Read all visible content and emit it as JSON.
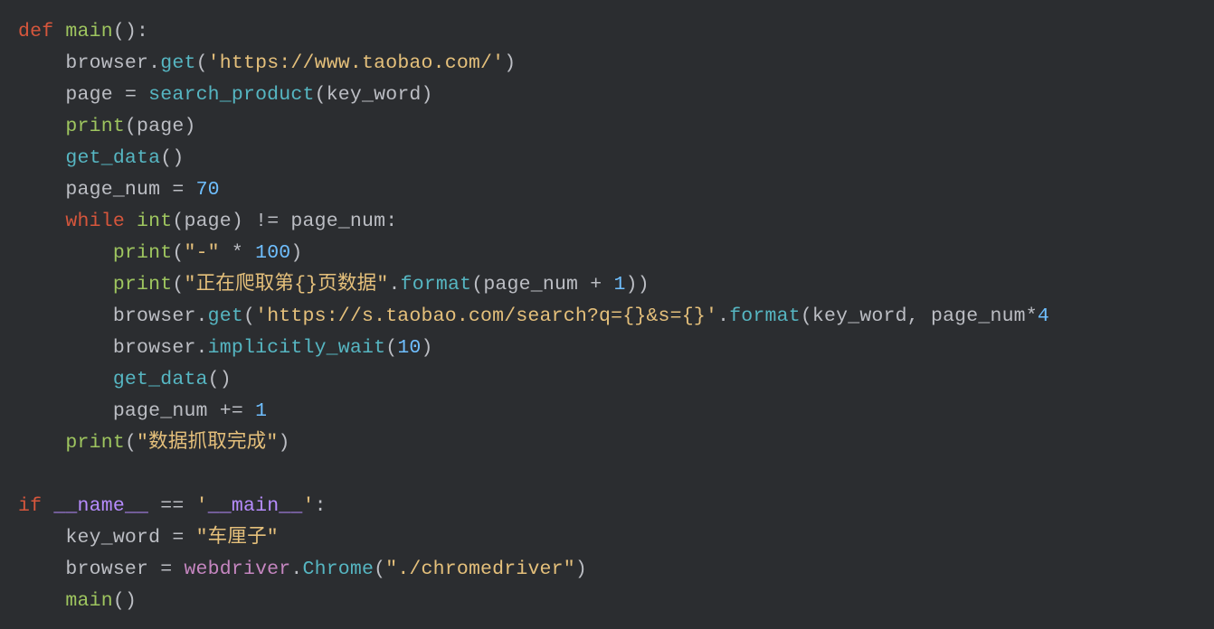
{
  "code": {
    "l1": {
      "kw": "def",
      "sp": " ",
      "name": "main",
      "paren": "():"
    },
    "l2": {
      "indent": "    ",
      "obj": "browser",
      "dot": ".",
      "meth": "get",
      "open": "(",
      "q": "'",
      "str": "https://www.taobao.com/",
      "q2": "'",
      "close": ")"
    },
    "l3": {
      "indent": "    ",
      "lhs": "page",
      "eq": " = ",
      "fn": "search_product",
      "open": "(",
      "arg": "key_word",
      "close": ")"
    },
    "l4": {
      "indent": "    ",
      "fn": "print",
      "open": "(",
      "arg": "page",
      "close": ")"
    },
    "l5": {
      "indent": "    ",
      "fn": "get_data",
      "paren": "()"
    },
    "l6": {
      "indent": "    ",
      "lhs": "page_num",
      "eq": " = ",
      "num": "70"
    },
    "l7": {
      "indent": "    ",
      "kw": "while",
      "sp": " ",
      "fn": "int",
      "open": "(",
      "arg": "page",
      "close": ")",
      "op": " != ",
      "rhs": "page_num",
      "colon": ":"
    },
    "l8": {
      "indent": "        ",
      "fn": "print",
      "open": "(",
      "q": "\"",
      "str": "-",
      "q2": "\"",
      "op": " * ",
      "num": "100",
      "close": ")"
    },
    "l9": {
      "indent": "        ",
      "fn": "print",
      "open": "(",
      "q": "\"",
      "str": "正在爬取第{}页数据",
      "q2": "\"",
      "dot": ".",
      "meth": "format",
      "open2": "(",
      "arg": "page_num",
      "op": " + ",
      "num": "1",
      "close2": ")",
      ")": ")"
    },
    "l10": {
      "indent": "        ",
      "obj": "browser",
      "dot": ".",
      "meth": "get",
      "open": "(",
      "q": "'",
      "str": "https://s.taobao.com/search?q={}&s={}",
      "q2": "'",
      "dot2": ".",
      "meth2": "format",
      "open2": "(",
      "arg1": "key_word",
      "comma": ", ",
      "arg2": "page_num",
      "op": "*",
      "tail": "4"
    },
    "l11": {
      "indent": "        ",
      "obj": "browser",
      "dot": ".",
      "meth": "implicitly_wait",
      "open": "(",
      "num": "10",
      "close": ")"
    },
    "l12": {
      "indent": "        ",
      "fn": "get_data",
      "paren": "()"
    },
    "l13": {
      "indent": "        ",
      "lhs": "page_num",
      "op": " += ",
      "num": "1"
    },
    "l14": {
      "indent": "    ",
      "fn": "print",
      "open": "(",
      "q": "\"",
      "str": "数据抓取完成",
      "q2": "\"",
      "close": ")"
    },
    "blank": "",
    "l15": {
      "kw": "if",
      "sp": " ",
      "dund": "__name__",
      "eq": " == ",
      "q": "'",
      "dund2": "__main__",
      "q2": "'",
      "colon": ":"
    },
    "l16": {
      "indent": "    ",
      "lhs": "key_word",
      "eq": " = ",
      "q": "\"",
      "str": "车厘子",
      "q2": "\""
    },
    "l17": {
      "indent": "    ",
      "lhs": "browser",
      "eq": " = ",
      "mod": "webdriver",
      "dot": ".",
      "cls": "Chrome",
      "open": "(",
      "q": "\"",
      "str": "./chromedriver",
      "q2": "\"",
      "close": ")"
    },
    "l18": {
      "indent": "    ",
      "fn": "main",
      "paren": "()"
    }
  }
}
